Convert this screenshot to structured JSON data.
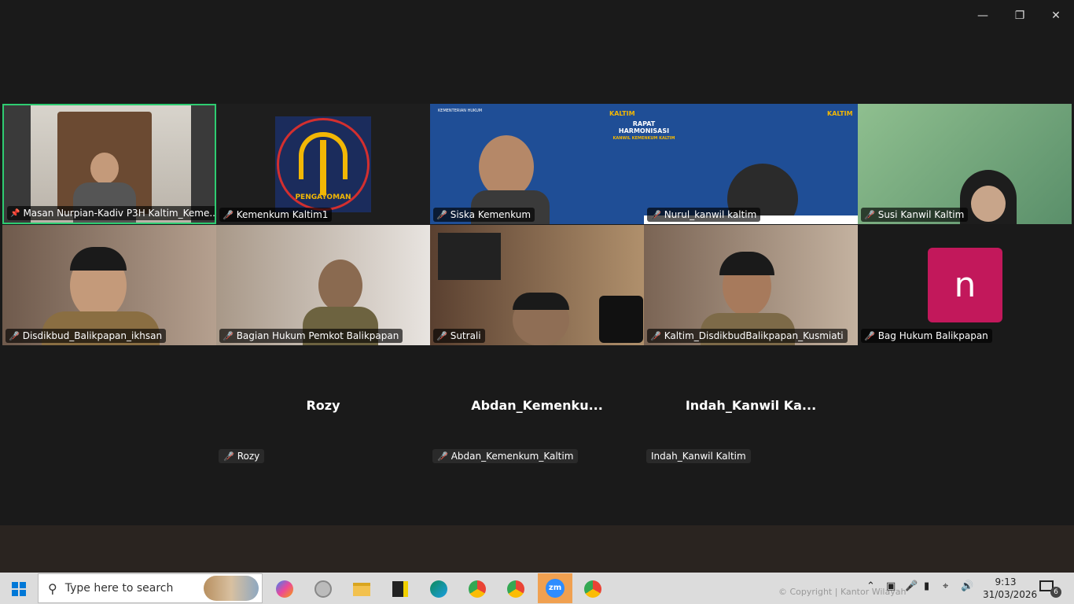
{
  "window": {
    "minimize_icon": "minimize-icon",
    "restore_icon": "restore-icon",
    "close_icon": "close-icon"
  },
  "tiles": [
    {
      "name": "Masan Nurpian-Kadiv P3H Kaltim_Keme...",
      "pinned": true,
      "muted": false
    },
    {
      "name": "Kemenkum Kaltim1",
      "muted": true,
      "logo_text": "PENGAYOMAN"
    },
    {
      "name": "Siska Kemenkum",
      "muted": true
    },
    {
      "name": "Nurul_kanwil kaltim",
      "muted": true,
      "banner_title": "RAPAT HARMONISASI",
      "banner_sub": "KANWIL KEMENKUM KALTIM",
      "banner_brand": "KALTIM",
      "banner_org": "KEMENTERIAN HUKUM"
    },
    {
      "name": "Susi Kanwil Kaltim",
      "muted": true
    },
    {
      "name": "Disdikbud_Balikpapan_ikhsan",
      "muted": true
    },
    {
      "name": "Bagian Hukum Pemkot Balikpapan",
      "muted": true
    },
    {
      "name": "Sutrali",
      "muted": true
    },
    {
      "name": "Kaltim_DisdikbudBalikpapan_Kusmiati",
      "muted": true
    },
    {
      "name": "Bag Hukum Balikpapan",
      "muted": true,
      "avatar_letter": "n"
    }
  ],
  "no_video": [
    {
      "big": "Rozy",
      "small": "Rozy",
      "muted": true
    },
    {
      "big": "Abdan_Kemenku...",
      "small": "Abdan_Kemenkum_Kaltim",
      "muted": true
    },
    {
      "big": "Indah_Kanwil  Ka...",
      "small": "Indah_Kanwil Kaltim",
      "muted": false
    }
  ],
  "taskbar": {
    "search_placeholder": "Type here to search",
    "time": "9:13",
    "date": "31/03/2026",
    "copyright": "© Copyright | Kantor Wilayah",
    "notification_count": "6"
  },
  "colors": {
    "active_speaker": "#2ecc71",
    "mute": "#e74c3c",
    "avatar_bg": "#c2185b",
    "banner_bg": "#1f4e96"
  }
}
